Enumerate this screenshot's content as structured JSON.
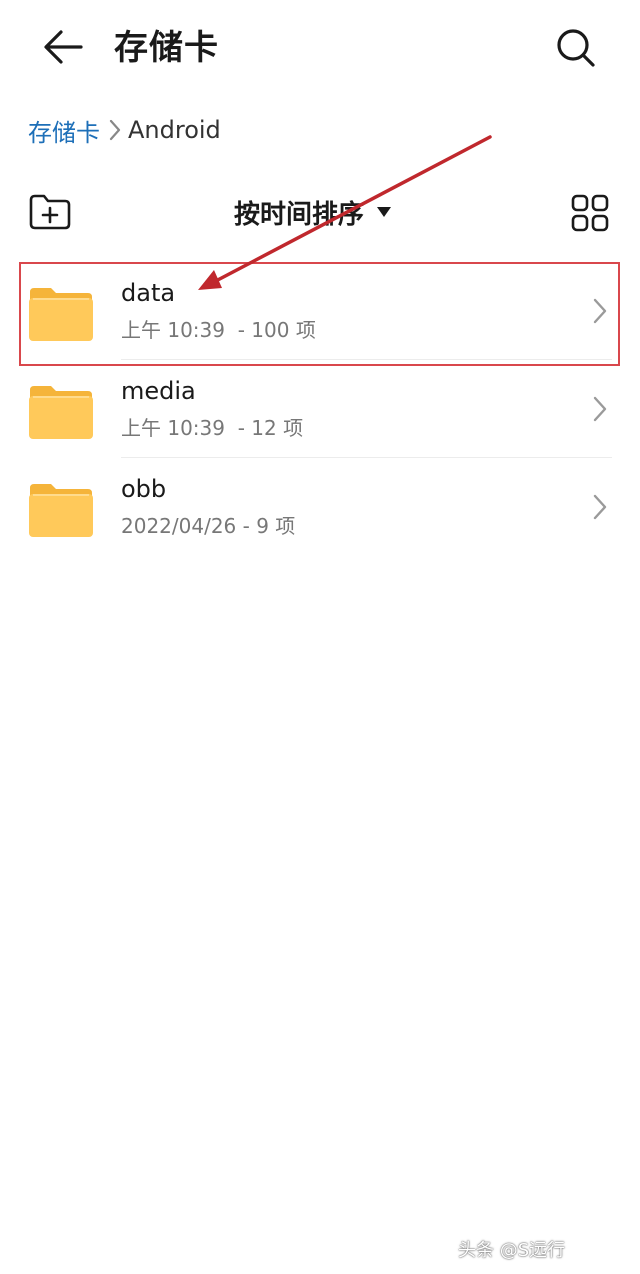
{
  "header": {
    "title": "存储卡",
    "back_icon": "arrow-left-icon",
    "search_icon": "search-icon"
  },
  "breadcrumb": {
    "root": "存储卡",
    "current": "Android",
    "separator_icon": "chevron-right-icon"
  },
  "toolbar": {
    "new_folder_icon": "folder-add-icon",
    "sort_label": "按时间排序",
    "sort_caret_icon": "caret-down-icon",
    "view_icon": "grid-view-icon"
  },
  "files": [
    {
      "name": "data",
      "meta": "上午 10:39  - 100 项",
      "highlighted": true
    },
    {
      "name": "media",
      "meta": "上午 10:39  - 12 项",
      "highlighted": false
    },
    {
      "name": "obb",
      "meta": "2022/04/26 - 9 项",
      "highlighted": false
    }
  ],
  "annotation": {
    "highlight_color": "#d9474c",
    "arrow_color": "#c0282d"
  },
  "colors": {
    "folder": "#ffc95a",
    "folder_tab": "#f5b43a",
    "link": "#1d6fb8"
  },
  "watermark": "头条 @S远行"
}
